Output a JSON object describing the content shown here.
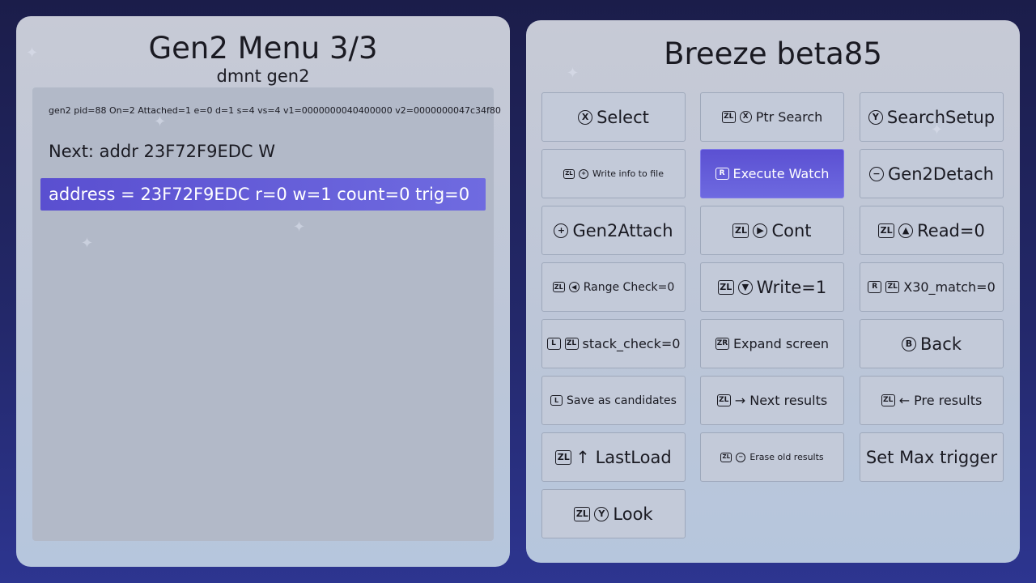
{
  "left": {
    "title": "Gen2 Menu 3/3",
    "subtitle": "dmnt gen2",
    "status": "gen2 pid=88 On=2 Attached=1 e=0 d=1 s=4 vs=4 v1=0000000040400000 v2=0000000047c34f80",
    "next": "Next: addr 23F72F9EDC W",
    "selected_row": "address = 23F72F9EDC r=0 w=1 count=0 trig=0"
  },
  "right": {
    "title": "Breeze beta85",
    "buttons": [
      {
        "label": "Select",
        "size": "l",
        "icons": [
          {
            "t": "X",
            "s": "circle"
          }
        ]
      },
      {
        "label": "Ptr Search",
        "size": "m",
        "icons": [
          {
            "t": "ZL",
            "s": "sq"
          },
          {
            "t": "X",
            "s": "circle"
          }
        ]
      },
      {
        "label": "SearchSetup",
        "size": "l",
        "icons": [
          {
            "t": "Y",
            "s": "circle"
          }
        ]
      },
      {
        "label": "Write info to file",
        "size": "xs",
        "icons": [
          {
            "t": "ZL",
            "s": "sq"
          },
          {
            "t": "+",
            "s": "circle"
          }
        ]
      },
      {
        "label": "Execute Watch",
        "size": "m",
        "selected": true,
        "icons": [
          {
            "t": "R",
            "s": "sq"
          }
        ]
      },
      {
        "label": "Gen2Detach",
        "size": "l",
        "icons": [
          {
            "t": "−",
            "s": "circle"
          }
        ]
      },
      {
        "label": "Gen2Attach",
        "size": "l",
        "icons": [
          {
            "t": "+",
            "s": "circle"
          }
        ]
      },
      {
        "label": "Cont",
        "size": "l",
        "icons": [
          {
            "t": "ZL",
            "s": "sq"
          },
          {
            "t": "▶",
            "s": "circle"
          }
        ]
      },
      {
        "label": "Read=0",
        "size": "l",
        "icons": [
          {
            "t": "ZL",
            "s": "sq"
          },
          {
            "t": "▲",
            "s": "circle"
          }
        ]
      },
      {
        "label": "Range Check=0",
        "size": "s",
        "icons": [
          {
            "t": "ZL",
            "s": "sq"
          },
          {
            "t": "◀",
            "s": "circle"
          }
        ]
      },
      {
        "label": "Write=1",
        "size": "l",
        "icons": [
          {
            "t": "ZL",
            "s": "sq"
          },
          {
            "t": "▼",
            "s": "circle"
          }
        ]
      },
      {
        "label": "X30_match=0",
        "size": "m",
        "icons": [
          {
            "t": "R",
            "s": "sq"
          },
          {
            "t": "ZL",
            "s": "sq"
          }
        ]
      },
      {
        "label": "stack_check=0",
        "size": "m",
        "icons": [
          {
            "t": "L",
            "s": "sq"
          },
          {
            "t": "ZL",
            "s": "sq"
          }
        ]
      },
      {
        "label": "Expand screen",
        "size": "m",
        "icons": [
          {
            "t": "ZR",
            "s": "sq"
          }
        ]
      },
      {
        "label": "Back",
        "size": "l",
        "icons": [
          {
            "t": "B",
            "s": "circle"
          }
        ]
      },
      {
        "label": "Save as candidates",
        "size": "s",
        "icons": [
          {
            "t": "L",
            "s": "sq"
          }
        ]
      },
      {
        "label": "→ Next results",
        "size": "m",
        "icons": [
          {
            "t": "ZL",
            "s": "sq"
          }
        ]
      },
      {
        "label": "← Pre results",
        "size": "m",
        "icons": [
          {
            "t": "ZL",
            "s": "sq"
          }
        ]
      },
      {
        "label": "↑ LastLoad",
        "size": "l",
        "icons": [
          {
            "t": "ZL",
            "s": "sq"
          }
        ]
      },
      {
        "label": "Erase old results",
        "size": "xs",
        "icons": [
          {
            "t": "ZL",
            "s": "sq"
          },
          {
            "t": "−",
            "s": "circle"
          }
        ]
      },
      {
        "label": "Set Max trigger",
        "size": "l",
        "icons": []
      },
      {
        "label": "Look",
        "size": "l",
        "icons": [
          {
            "t": "ZL",
            "s": "sq"
          },
          {
            "t": "Y",
            "s": "circle"
          }
        ]
      }
    ]
  },
  "colors": {
    "selected": "#5b50d2",
    "panel": "#c7cad6"
  }
}
